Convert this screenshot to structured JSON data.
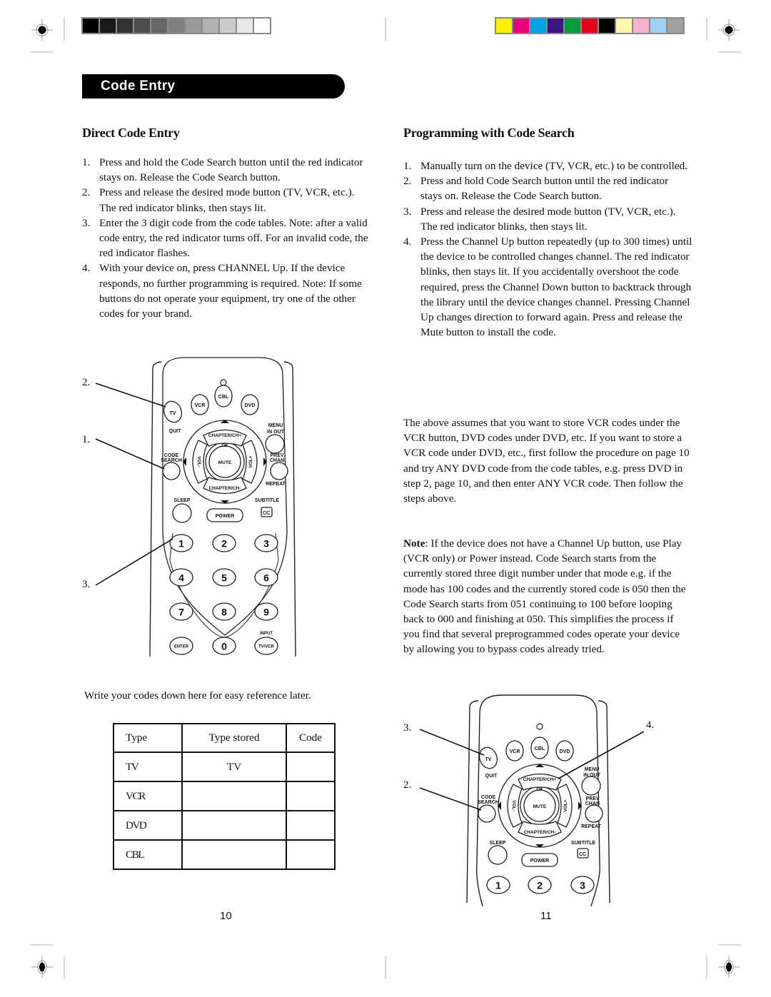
{
  "print_marks": {
    "grayscale_bar": [
      "#000000",
      "#1a1a1a",
      "#333333",
      "#4d4d4d",
      "#666666",
      "#808080",
      "#999999",
      "#b3b3b3",
      "#cccccc",
      "#e6e6e6",
      "#ffffff"
    ],
    "color_bar": [
      "#fff200",
      "#e4007c",
      "#00a0e3",
      "#3b1683",
      "#009a3e",
      "#e2001a",
      "#000000",
      "#fff8b0",
      "#f6b1cc",
      "#9fd3f4",
      "#a0a0a0"
    ]
  },
  "header": {
    "section_title": "Code Entry"
  },
  "left": {
    "title": "Direct Code Entry",
    "steps": [
      {
        "num": "1.",
        "text": "Press and hold the Code Search button until the red indicator stays on. Release the Code Search button."
      },
      {
        "num": "2.",
        "text": "Press and release the desired mode button (TV, VCR, etc.).",
        "sub": "The red indicator blinks, then stays lit."
      },
      {
        "num": "3.",
        "text": "Enter the 3 digit code from the code tables. Note: after a valid code entry, the red indicator turns off. For an invalid code, the red indicator flashes."
      },
      {
        "num": "4.",
        "text": "With your device on, press CHANNEL Up. If the device responds, no further programming is required. Note: If some buttons do not operate your equipment, try one of the other codes for your brand."
      }
    ],
    "figure_callouts": [
      "2.",
      "1.",
      "3."
    ],
    "write_codes_text": "Write your codes down here for easy reference later.",
    "code_table": {
      "headers": [
        "Type",
        "Type  stored",
        "Code"
      ],
      "rows": [
        [
          "TV",
          "TV",
          ""
        ],
        [
          "VCR",
          "",
          ""
        ],
        [
          "DVD",
          "",
          ""
        ],
        [
          "CBL",
          "",
          ""
        ]
      ]
    },
    "page_number": "10"
  },
  "right": {
    "title": "Programming with Code Search",
    "steps": [
      {
        "num": "1.",
        "text": "Manually turn on the device (TV, VCR, etc.) to be controlled."
      },
      {
        "num": "2.",
        "text": "Press and hold Code Search button until the red indicator stays on. Release the Code Search button."
      },
      {
        "num": "3.",
        "text": "Press and release the desired mode button (TV, VCR, etc.).",
        "sub": "The red indicator blinks, then stays lit."
      },
      {
        "num": "4.",
        "text": "Press the Channel Up button repeatedly (up to 300 times) until the device to be controlled changes channel. The red indicator blinks, then stays lit.  If you accidentally overshoot the code required, press the Channel Down button to backtrack through the library until the device changes channel. Pressing Channel Up changes direction to forward again. Press and release the Mute button to install the code."
      }
    ],
    "paragraph": "The above assumes that you want to store VCR codes under the VCR button, DVD codes under DVD, etc. If you want to store a VCR code under DVD, etc., first follow the procedure on page 10 and try ANY DVD code from the code tables, e.g. press DVD in step 2, page 10, and then enter ANY VCR code. Then follow the steps above.",
    "note_label": "Note",
    "note_text": ":  If the device does not have a Channel Up button, use Play (VCR only) or Power instead. Code Search starts from the currently stored three digit number under that mode e.g. if the mode has 100 codes and the currently stored code is 050 then the Code Search starts from 051 continuing to 100 before looping back to 000 and finishing at 050.  This simplifies the process if you find that several preprogrammed codes operate your device by allowing you to bypass codes already tried.",
    "figure_callouts": [
      "3.",
      "4.",
      "2."
    ],
    "page_number": "11"
  },
  "remote": {
    "mode_buttons": [
      "TV",
      "VCR",
      "CBL",
      "DVD"
    ],
    "labels": {
      "quit": "QUIT",
      "menu": "MENU",
      "in_out": "IN OUT",
      "code": "CODE",
      "search": "SEARCH",
      "prev": "PREV",
      "chan": "CHAN",
      "chapter_up": "CHAPTER/CH+",
      "chapter_down": "CHAPTER/CH-",
      "ok": "OK",
      "mute": "MUTE",
      "vol_minus": "VOL-",
      "vol_plus": "VOL+",
      "repeat": "REPEAT",
      "sleep": "SLEEP",
      "subtitle": "SUBTITLE",
      "cc": "CC",
      "power": "POWER",
      "input": "INPUT",
      "enter": "ENTER",
      "tv_vcr": "TV/VCR"
    },
    "digits": [
      "1",
      "2",
      "3",
      "4",
      "5",
      "6",
      "7",
      "8",
      "9",
      "0"
    ]
  }
}
